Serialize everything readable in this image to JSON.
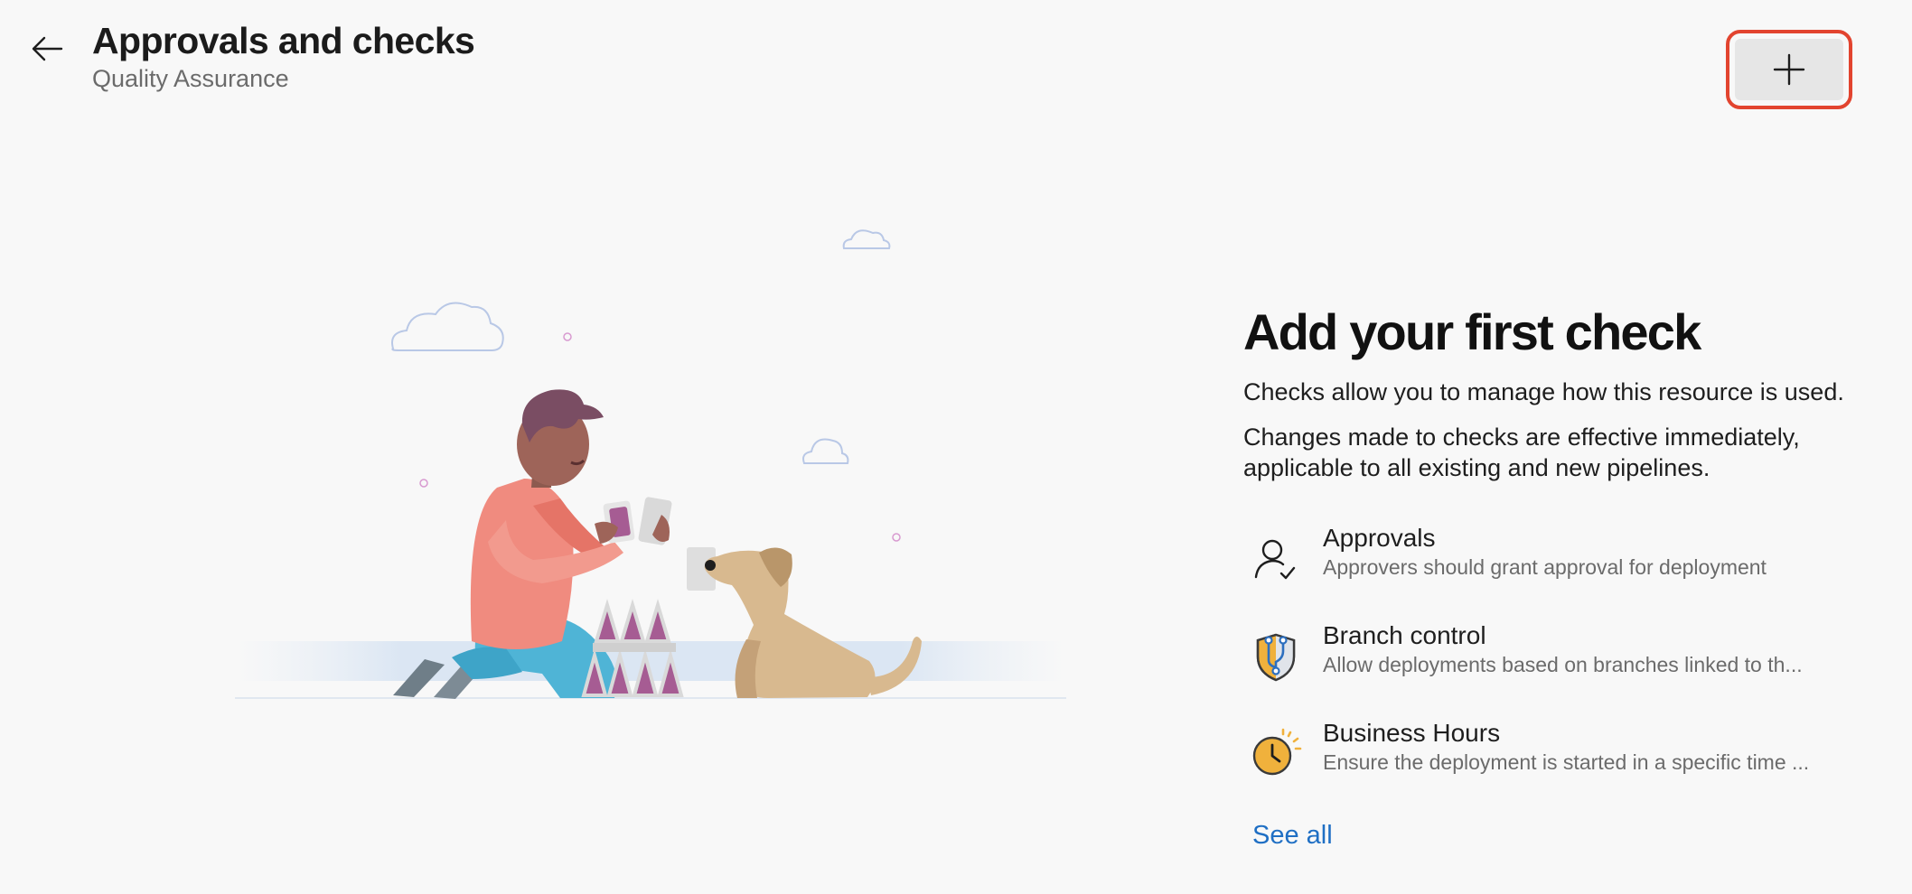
{
  "header": {
    "title": "Approvals and checks",
    "subtitle": "Quality Assurance",
    "back_icon": "arrow-left-icon",
    "add_icon": "plus-icon",
    "highlight_color": "#e2442f"
  },
  "empty_state": {
    "title": "Add your first check",
    "description_1": "Checks allow you to manage how this resource is used.",
    "description_2": "Changes made to checks are effective immediately, applicable to all existing and new pipelines.",
    "illustration": "person-building-card-house-with-dog"
  },
  "checks": [
    {
      "name": "Approvals",
      "description": "Approvers should grant approval for deployment",
      "icon": "person-check-icon"
    },
    {
      "name": "Branch control",
      "description": "Allow deployments based on branches linked to th...",
      "icon": "shield-branch-icon"
    },
    {
      "name": "Business Hours",
      "description": "Ensure the deployment is started in a specific time ...",
      "icon": "clock-icon"
    }
  ],
  "see_all_label": "See all",
  "colors": {
    "link": "#1f6fc4",
    "background": "#f8f8f8"
  }
}
